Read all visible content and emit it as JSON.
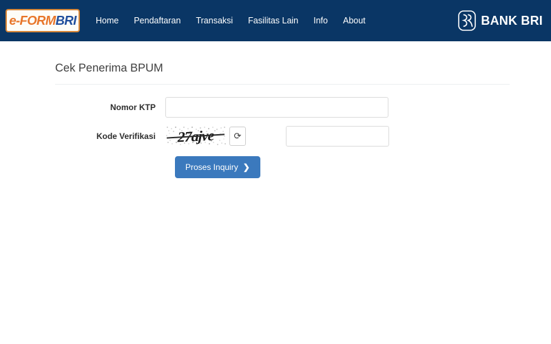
{
  "header": {
    "logo": {
      "part1": "e-FORM",
      "part2": "BRI",
      "icon": "eform-bri-logo"
    },
    "nav_items": [
      {
        "label": "Home"
      },
      {
        "label": "Pendaftaran"
      },
      {
        "label": "Transaksi"
      },
      {
        "label": "Fasilitas Lain"
      },
      {
        "label": "Info"
      },
      {
        "label": "About"
      }
    ],
    "bank_logo": {
      "mark_icon": "bri-mark-icon",
      "name": "BANK BRI"
    },
    "colors": {
      "navbar_bg": "#0a3665",
      "logo_orange": "#e8762a",
      "logo_blue": "#1f4e9c",
      "logo_border": "#d8883a"
    }
  },
  "main": {
    "title": "Cek Penerima BPUM",
    "form": {
      "ktp": {
        "label": "Nomor KTP",
        "value": "",
        "placeholder": ""
      },
      "captcha": {
        "label": "Kode Verifikasi",
        "image_text": "27ajve",
        "image_icon": "captcha-image",
        "refresh_icon": "refresh-icon",
        "refresh_glyph": "⟳",
        "value": "",
        "placeholder": ""
      },
      "submit": {
        "label": "Proses Inquiry",
        "chevron": "❯"
      }
    },
    "colors": {
      "title_text": "#3f3f3f",
      "divider": "#eceff1",
      "input_border": "#dcdcdc",
      "button_blue": "#3b79bd"
    }
  }
}
